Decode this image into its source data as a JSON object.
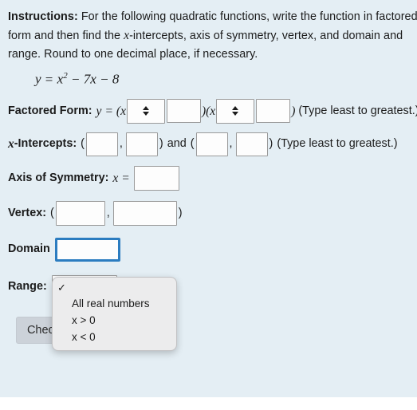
{
  "page": {
    "background_color": "#e4eef4",
    "text_color": "#1b1b1b",
    "accent_color": "#2b7cc0"
  },
  "instructions": {
    "label": "Instructions:",
    "text_part1": " For the following quadratic functions, write the function in factored form and then find the ",
    "xvar": "x",
    "text_part2": "-intercepts, axis of symmetry, vertex, and domain and range.  Round to one decimal place, if necessary."
  },
  "equation": {
    "lhs": "y",
    "equals": "=",
    "term1_base": "x",
    "term1_exp": "2",
    "op1": "−",
    "term2": "7x",
    "op2": "−",
    "term3": "8"
  },
  "factored_form": {
    "label": "Factored Form:",
    "y": "y",
    "equals": "=",
    "open_paren1": "(",
    "x1": "x",
    "close_open": ")(",
    "x2": "x",
    "close_paren": ")",
    "hint": " (Type least to greatest.)",
    "sign_select_1": {
      "name": "sign-select-1",
      "value": "",
      "options": [
        "",
        "+",
        "−"
      ]
    },
    "value_input_1": {
      "name": "factor-value-1",
      "value": "",
      "placeholder": ""
    },
    "sign_select_2": {
      "name": "sign-select-2",
      "value": "",
      "options": [
        "",
        "+",
        "−"
      ]
    },
    "value_input_2": {
      "name": "factor-value-2",
      "value": "",
      "placeholder": ""
    }
  },
  "x_intercepts": {
    "label_x": "x",
    "label_rest": "-Intercepts:",
    "open1": "(",
    "comma1": ",",
    "close1": ")",
    "and": " and ",
    "open2": "(",
    "comma2": ",",
    "close2": ")",
    "hint": " (Type least to greatest.)",
    "input_1": {
      "name": "x-intercept-1-x",
      "value": ""
    },
    "input_2": {
      "name": "x-intercept-1-y",
      "value": ""
    },
    "input_3": {
      "name": "x-intercept-2-x",
      "value": ""
    },
    "input_4": {
      "name": "x-intercept-2-y",
      "value": ""
    }
  },
  "axis_of_symmetry": {
    "label": "Axis of Symmetry:",
    "xvar": "x",
    "equals": "=",
    "input": {
      "name": "axis-of-symmetry-input",
      "value": ""
    }
  },
  "vertex": {
    "label": "Vertex:",
    "open": "(",
    "comma": ",",
    "close": ")",
    "input_x": {
      "name": "vertex-x-input",
      "value": ""
    },
    "input_y": {
      "name": "vertex-y-input",
      "value": ""
    }
  },
  "domain": {
    "label": "Domain",
    "select_value": "",
    "focused": true
  },
  "range": {
    "label": "Range:",
    "select_value": ""
  },
  "dropdown": {
    "open": true,
    "selected_index": 0,
    "check_glyph": "✓",
    "items": [
      {
        "label": "",
        "checked": true
      },
      {
        "label": "All real numbers",
        "checked": false
      },
      {
        "label": "x > 0",
        "checked": false
      },
      {
        "label": "x < 0",
        "checked": false
      }
    ]
  },
  "check_button": {
    "label": "Check"
  }
}
